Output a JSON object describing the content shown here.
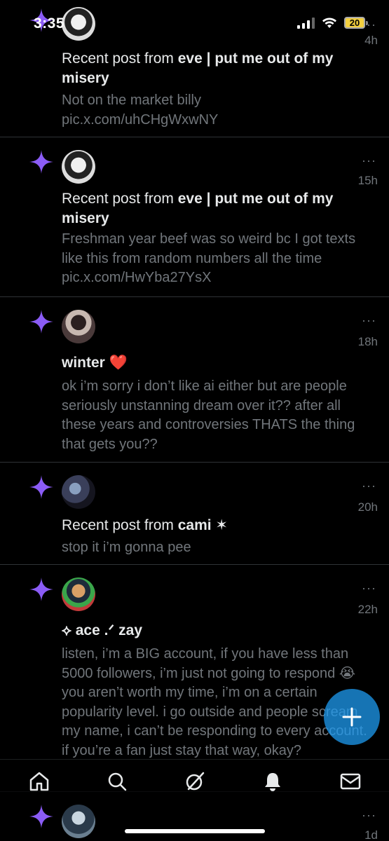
{
  "status": {
    "time": "3:35",
    "battery": "20"
  },
  "notifications": [
    {
      "title_prefix": "Recent post from ",
      "title_name": "eve | put me out of my misery",
      "body": "Not on the market billy pic.x.com/uhCHgWxwNY",
      "time": "4h"
    },
    {
      "title_prefix": "Recent post from ",
      "title_name": "eve | put me out of my misery",
      "body": "Freshman year beef was so weird bc I got texts like this from random numbers all the time pic.x.com/HwYba27YsX",
      "time": "15h"
    },
    {
      "title_prefix": "",
      "title_name": "winter ❤️",
      "body": "ok i’m sorry i don’t like ai either but are people seriously unstanning dream over it?? after all these years and controversies THATS the thing that gets you??",
      "time": "18h"
    },
    {
      "title_prefix": "Recent post from ",
      "title_name": "cami ✶",
      "body": "stop it i’m gonna pee",
      "time": "20h"
    },
    {
      "title_prefix": "",
      "title_name": "⟡ ace .ᐟ zay",
      "body": "listen, i’m a BIG account, if you have less than 5000 followers, i’m just not going to respond 😭 you aren’t worth my time, i’m on a certain popularity level. i go outside and people scream my name, i can’t be responding to every account. if you’re a fan just stay that way, okay?",
      "time": "22h"
    },
    {
      "time": "1d"
    }
  ],
  "more_glyph": "···",
  "fab_icon": "plus-icon",
  "nav": [
    "home-icon",
    "search-icon",
    "grok-icon",
    "bell-icon",
    "mail-icon"
  ],
  "colors": {
    "accent": "#1d9bf0",
    "sparkle": "#8b5cf6",
    "muted": "#71767b"
  }
}
